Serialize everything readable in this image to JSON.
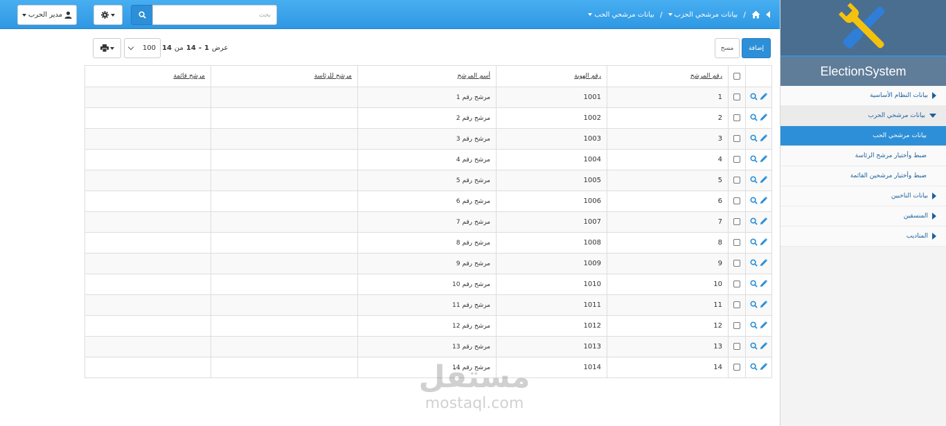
{
  "topbar": {
    "user_label": "مدير الحرب",
    "search_placeholder": "بحث",
    "breadcrumb": [
      {
        "label": "بيانات مرشحي الحزب"
      },
      {
        "label": "بيانات مرشحي الحب"
      }
    ],
    "separator": "/"
  },
  "sidebar": {
    "brand": "ElectionSystem",
    "items": [
      {
        "label": "بيانات النظام الأساسية"
      },
      {
        "label": "بيانات مرشحي الحرب"
      },
      {
        "label": "بيانات مرشحي الحب"
      },
      {
        "label": "ضبط وأختيار مرشح الرئاسة"
      },
      {
        "label": "ضبط وأختيار مرشحين القائمة"
      },
      {
        "label": "بيانات الناخبين"
      },
      {
        "label": "المنسقين"
      },
      {
        "label": "المناديب"
      }
    ]
  },
  "toolbar": {
    "add_label": "إضافة",
    "clear_label": "مسح",
    "page_size": "100",
    "page_info_prefix": "عرض",
    "range_start": "1",
    "range_dash": "-",
    "range_end": "14",
    "of_label": "من",
    "total": "14"
  },
  "table": {
    "headers": {
      "candidate_no": "رقم المرشح",
      "national_id": "رقم الهوية",
      "candidate_name": "أسم المرشح",
      "presidential_candidate": "مرشح للرئاسة",
      "list_candidate": "مرشح قائمة"
    },
    "rows": [
      {
        "no": "1",
        "id": "1001",
        "name": "مرشح رقم 1"
      },
      {
        "no": "2",
        "id": "1002",
        "name": "مرشح رقم 2"
      },
      {
        "no": "3",
        "id": "1003",
        "name": "مرشح رقم 3"
      },
      {
        "no": "4",
        "id": "1004",
        "name": "مرشح رقم 4"
      },
      {
        "no": "5",
        "id": "1005",
        "name": "مرشح رقم 5"
      },
      {
        "no": "6",
        "id": "1006",
        "name": "مرشح رقم 6"
      },
      {
        "no": "7",
        "id": "1007",
        "name": "مرشح رقم 7"
      },
      {
        "no": "8",
        "id": "1008",
        "name": "مرشح رقم 8"
      },
      {
        "no": "9",
        "id": "1009",
        "name": "مرشح رقم 9"
      },
      {
        "no": "10",
        "id": "1010",
        "name": "مرشح رقم 10"
      },
      {
        "no": "11",
        "id": "1011",
        "name": "مرشح رقم 11"
      },
      {
        "no": "12",
        "id": "1012",
        "name": "مرشح رقم 12"
      },
      {
        "no": "13",
        "id": "1013",
        "name": "مرشح رقم 13"
      },
      {
        "no": "14",
        "id": "1014",
        "name": "مرشح رقم 14"
      }
    ]
  },
  "watermark": {
    "arabic": "مستقل",
    "latin": "mostaql.com"
  },
  "colors": {
    "primary": "#2d8fd8",
    "topbar": "#3aa3ec",
    "logo_bg": "#4a6e8f",
    "link": "#1a5f9c"
  },
  "icons": {
    "home": "home-icon",
    "user": "user-icon",
    "gear": "gear-icon",
    "search": "search-icon",
    "print": "print-icon",
    "edit": "pencil-icon",
    "view": "magnifier-icon",
    "logo": "tools-icon"
  }
}
